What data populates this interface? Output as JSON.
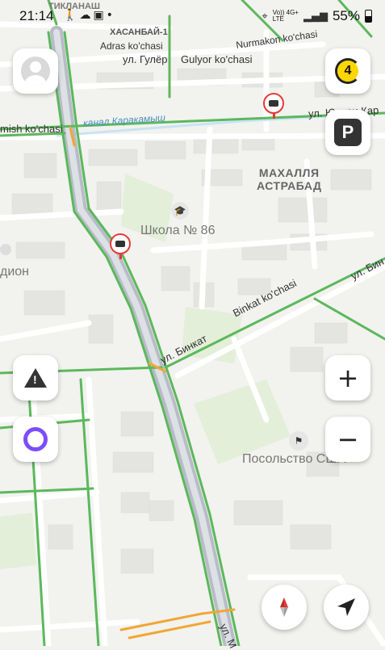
{
  "status_bar": {
    "time": "21:14",
    "network_line1": "Vo))",
    "network_line2": "LTE",
    "network_type": "4G+",
    "battery": "55%"
  },
  "map": {
    "streets": {
      "tiklanash": "ТИКЛАНАШ",
      "xasanbay": "ХАСАНБАЙ-1",
      "adras": "Adras ko'chasi",
      "gulyor_ru": "ул. Гулёр",
      "gulyor_uz": "Gulyor ko'chasi",
      "nurmakon": "Nurmakon ko'chasi",
      "karakamysh_canal": "канал Каракамыш",
      "mish": "mish ko'chasi",
      "yukori": "ул. Юкори Кар",
      "binkat_uz": "Binkat ko'chasi",
      "binkat_ru": "ул. Бинкат",
      "binkat_right": "ул. Бин",
      "bottom_street": "ул. М"
    },
    "districts": {
      "mahalla_line1": "МАХАЛЛЯ",
      "mahalla_line2": "АСТРАБАД"
    },
    "pois": {
      "school": "Школа № 86",
      "embassy": "Посольство США",
      "stadium": "дион"
    }
  },
  "controls": {
    "profile": "avatar-icon",
    "traffic_score": "4",
    "parking": "P",
    "report": "!",
    "alice": "alice-icon",
    "zoom_in": "+",
    "zoom_out": "−",
    "compass": "compass-icon",
    "locate": "locate-icon"
  },
  "colors": {
    "traffic_free": "#5cb85c",
    "traffic_slow": "#f0a732",
    "camera": "#e53935",
    "alice": "#7b4dff",
    "score_badge": "#ffd600"
  }
}
